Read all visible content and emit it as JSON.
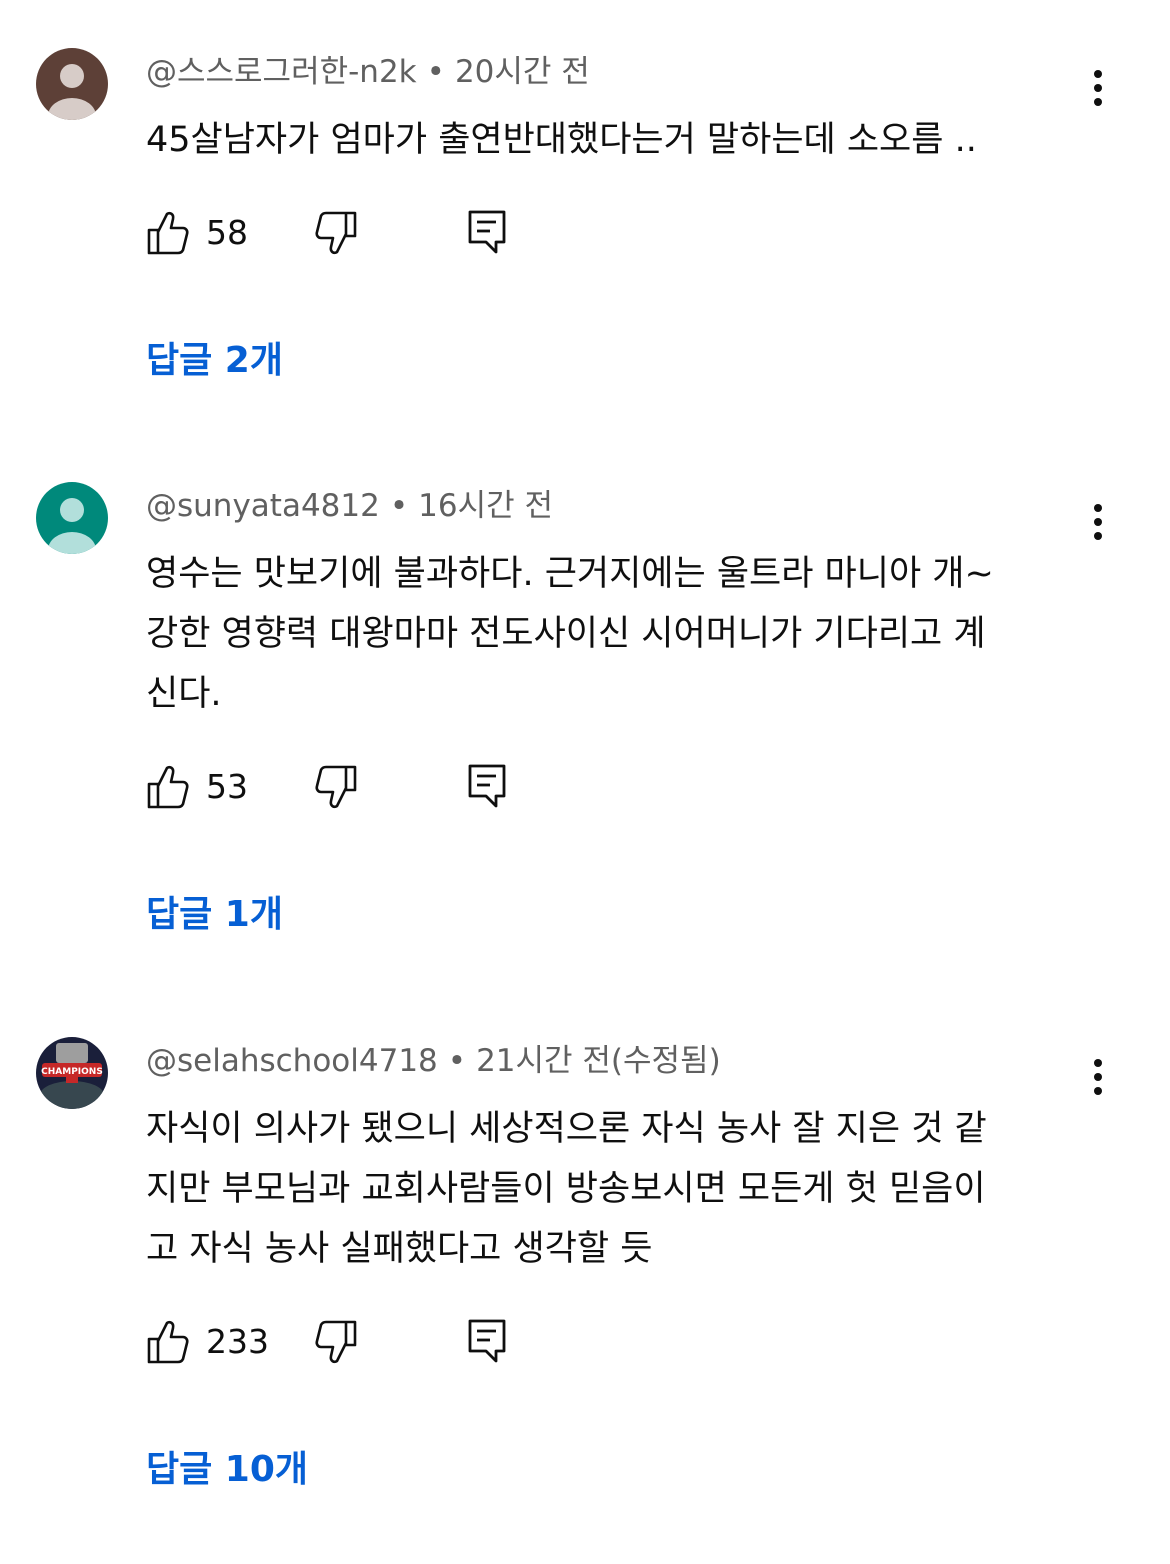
{
  "comments": [
    {
      "author": "@스스로그러한-n2k",
      "time": "20시간 전",
      "text": "45살남자가 엄마가 출연반대했다는거 말하는데 소오름 ..",
      "likes": "58",
      "replies": "답글 2개",
      "avatar": {
        "type": "default",
        "bg": "#5d4037",
        "fg": "#d7ccc8"
      }
    },
    {
      "author": "@sunyata4812",
      "time": "16시간 전",
      "text": "영수는 맛보기에 불과하다. 근거지에는 울트라 마니아 개~\n강한 영향력 대왕마마 전도사이신 시어머니가 기다리고 계\n신다.",
      "likes": "53",
      "replies": "답글 1개",
      "avatar": {
        "type": "default",
        "bg": "#00897b",
        "fg": "#b2dfdb"
      }
    },
    {
      "author": "@selahschool4718",
      "time": "21시간 전(수정됨)",
      "text": "자식이 의사가 됐으니 세상적으론 자식 농사 잘 지은 것 같\n지만 부모님과 교회사람들이 방송보시면 모든게 헛 믿음이\n고 자식 농사 실패했다고 생각할 듯",
      "likes": "233",
      "replies": "답글 10개",
      "avatar": {
        "type": "image",
        "label": "CHAMPIONS",
        "bg": "#1a1f3a",
        "fg": "#c62828"
      }
    }
  ],
  "meta_separator": "•",
  "colors": {
    "link": "#065fd4",
    "secondary_text": "#606060",
    "primary_text": "#0f0f0f"
  },
  "icons": {
    "like": "thumbs-up-icon",
    "dislike": "thumbs-down-icon",
    "reply": "reply-comment-icon",
    "more": "more-vertical-icon"
  }
}
